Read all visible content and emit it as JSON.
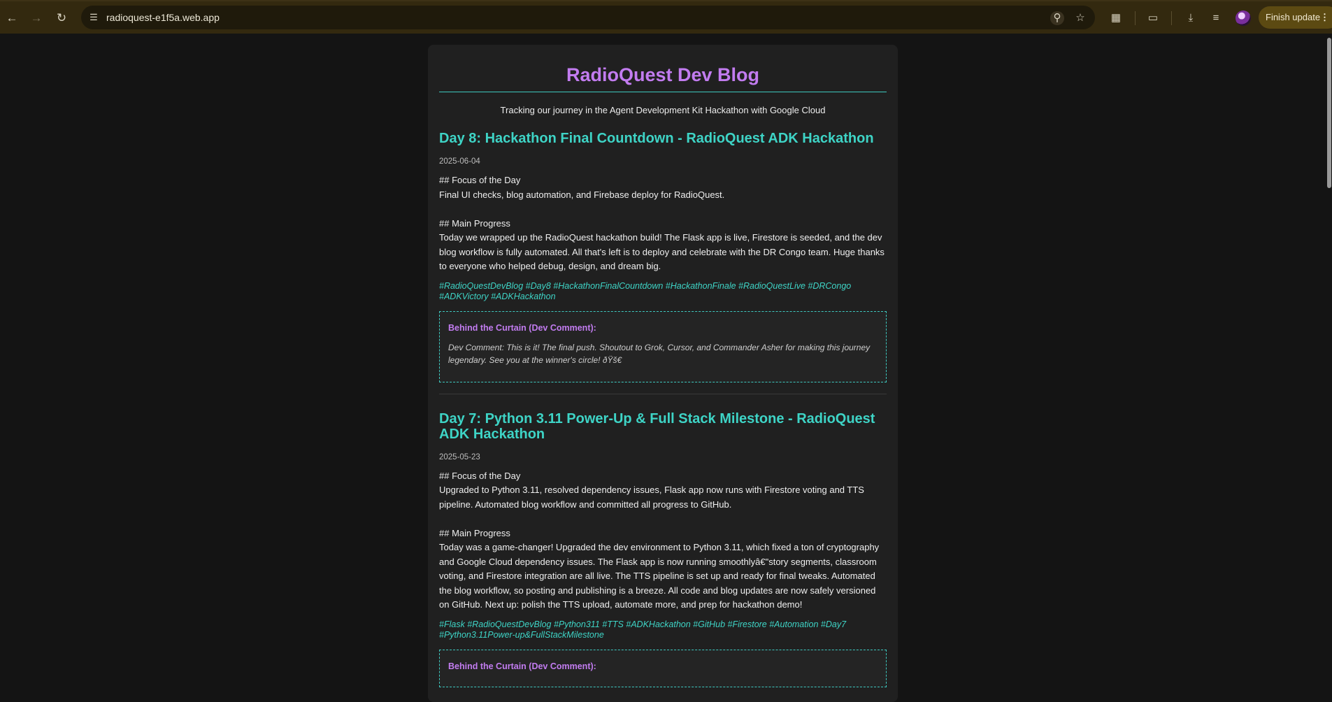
{
  "browser": {
    "url": "radioquest-e1f5a.web.app",
    "finish_update_label": "Finish update",
    "icons": {
      "back": "arrow-left-icon",
      "forward": "arrow-right-icon",
      "reload": "reload-icon",
      "site_info": "tune-icon",
      "zoom": "zoom-icon",
      "bookmark": "star-icon",
      "extensions": "puzzle-icon",
      "cast": "cast-icon",
      "downloads": "download-icon",
      "reading_list": "reading-list-icon",
      "menu": "kebab-menu-icon"
    }
  },
  "blog": {
    "title": "RadioQuest Dev Blog",
    "tagline": "Tracking our journey in the Agent Development Kit Hackathon with Google Cloud"
  },
  "posts": [
    {
      "title": "Day 8: Hackathon Final Countdown - RadioQuest ADK Hackathon",
      "date": "2025-06-04",
      "body": "## Focus of the Day\nFinal UI checks, blog automation, and Firebase deploy for RadioQuest.\n\n## Main Progress\nToday we wrapped up the RadioQuest hackathon build! The Flask app is live, Firestore is seeded, and the dev blog workflow is fully automated. All that's left is to deploy and celebrate with the DR Congo team. Huge thanks to everyone who helped debug, design, and dream big.",
      "hashtags": "#RadioQuestDevBlog #Day8 #HackathonFinalCountdown #HackathonFinale #RadioQuestLive #DRCongo #ADKVictory #ADKHackathon",
      "dev_comment_title": "Behind the Curtain (Dev Comment):",
      "dev_comment": "Dev Comment: This is it! The final push. Shoutout to Grok, Cursor, and Commander Asher for making this journey legendary. See you at the winner's circle! ðŸš€"
    },
    {
      "title": "Day 7: Python 3.11 Power-Up & Full Stack Milestone - RadioQuest ADK Hackathon",
      "date": "2025-05-23",
      "body": "## Focus of the Day\nUpgraded to Python 3.11, resolved dependency issues, Flask app now runs with Firestore voting and TTS pipeline. Automated blog workflow and committed all progress to GitHub.\n\n## Main Progress\nToday was a game-changer! Upgraded the dev environment to Python 3.11, which fixed a ton of cryptography and Google Cloud dependency issues. The Flask app is now running smoothlyâ€\"story segments, classroom voting, and Firestore integration are all live. The TTS pipeline is set up and ready for final tweaks. Automated the blog workflow, so posting and publishing is a breeze. All code and blog updates are now safely versioned on GitHub. Next up: polish the TTS upload, automate more, and prep for hackathon demo!",
      "hashtags": "#Flask #RadioQuestDevBlog #Python311 #TTS #ADKHackathon #GitHub #Firestore #Automation #Day7 #Python3.11Power-up&FullStackMilestone",
      "dev_comment_title": "Behind the Curtain (Dev Comment):"
    }
  ],
  "colors": {
    "accent_purple": "#c27cf0",
    "accent_teal": "#3ed4c6",
    "page_bg": "#141414",
    "card_bg": "#202020",
    "chrome_bg": "#33290f"
  }
}
